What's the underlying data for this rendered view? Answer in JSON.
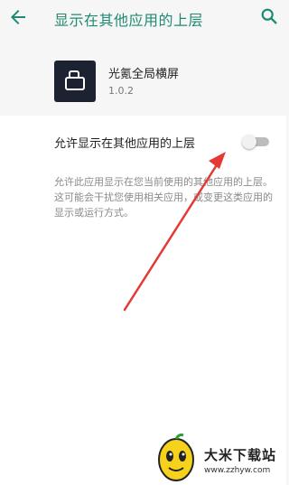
{
  "header": {
    "title": "显示在其他应用的上层",
    "back_icon": "arrow-back-icon",
    "search_icon": "search-icon",
    "accent": "#1f8a73"
  },
  "app": {
    "name": "光氪全局横屏",
    "version": "1.0.2",
    "icon_bg": "#1d2233"
  },
  "permission": {
    "label": "允许显示在其他应用的上层",
    "enabled": false,
    "description": "允许此应用显示在您当前使用的其他应用的上层。这可能会干扰您使用相关应用，或变更这类应用的显示或运行方式。"
  },
  "annotation": {
    "arrow_color": "#e53935"
  },
  "watermark": {
    "title": "大米下载站",
    "url": "www.zzhyw.com"
  }
}
